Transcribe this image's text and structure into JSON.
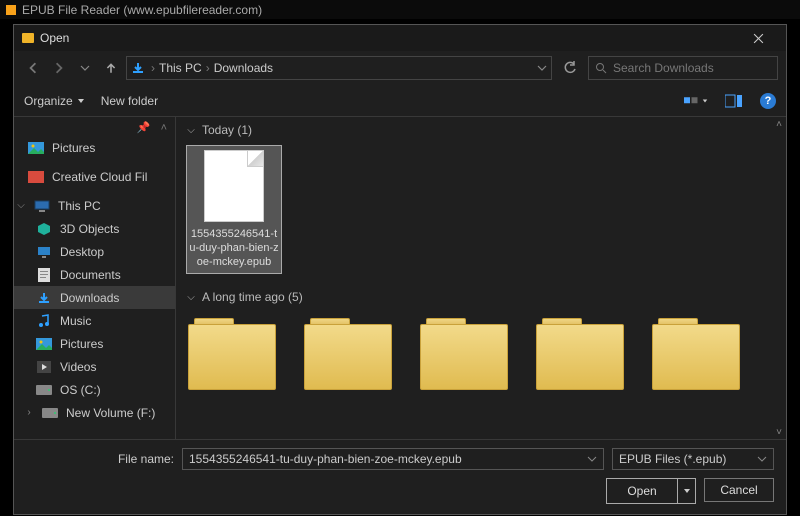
{
  "app": {
    "title": "EPUB File Reader (www.epubfilereader.com)"
  },
  "dialog": {
    "title": "Open",
    "breadcrumb": {
      "root": "This PC",
      "folder": "Downloads"
    },
    "search_placeholder": "Search Downloads",
    "toolbar": {
      "organize": "Organize",
      "new_folder": "New folder"
    },
    "sidebar": {
      "pin_label": "Pictures",
      "items": [
        {
          "label": "Pictures",
          "icon": "pictures"
        },
        {
          "label": "Creative Cloud Fil",
          "icon": "cc"
        },
        {
          "label": "This PC",
          "icon": "pc"
        },
        {
          "label": "3D Objects",
          "icon": "3d"
        },
        {
          "label": "Desktop",
          "icon": "desktop"
        },
        {
          "label": "Documents",
          "icon": "documents"
        },
        {
          "label": "Downloads",
          "icon": "downloads"
        },
        {
          "label": "Music",
          "icon": "music"
        },
        {
          "label": "Pictures",
          "icon": "pictures"
        },
        {
          "label": "Videos",
          "icon": "videos"
        },
        {
          "label": "OS (C:)",
          "icon": "drive"
        },
        {
          "label": "New Volume (F:)",
          "icon": "drive"
        }
      ],
      "selected_index": 6
    },
    "groups": {
      "today": {
        "label": "Today (1)"
      },
      "long_ago": {
        "label": "A long time ago (5)"
      }
    },
    "selected_file": {
      "name": "1554355246541-tu-duy-phan-bien-zoe-mckey.epub"
    },
    "footer": {
      "filename_label": "File name:",
      "filename_value": "1554355246541-tu-duy-phan-bien-zoe-mckey.epub",
      "filter": "EPUB Files (*.epub)",
      "open": "Open",
      "cancel": "Cancel"
    }
  }
}
